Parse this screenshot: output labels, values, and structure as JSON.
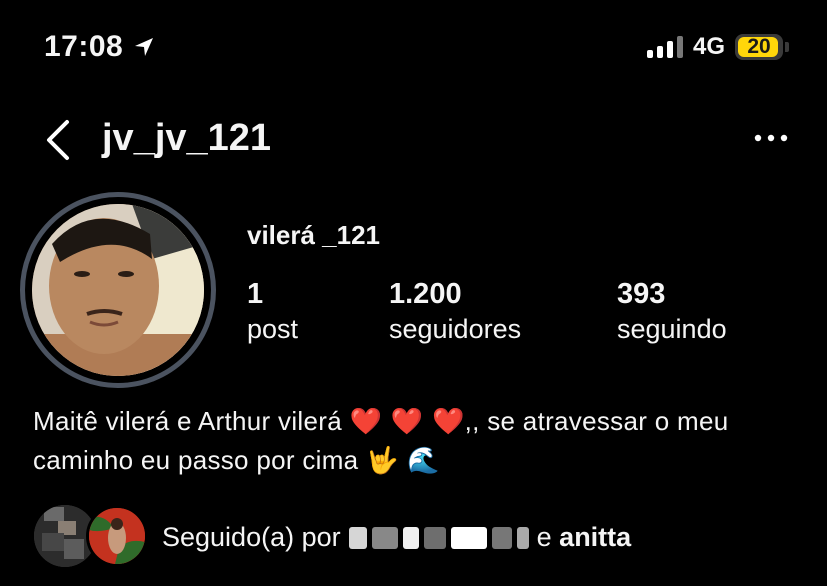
{
  "status_bar": {
    "time": "17:08",
    "network": "4G",
    "battery": "20"
  },
  "header": {
    "username": "jv_jv_121"
  },
  "profile": {
    "display_name": "vilerá _121",
    "stats": [
      {
        "value": "1",
        "label": "post"
      },
      {
        "value": "1.200",
        "label": "seguidores"
      },
      {
        "value": "393",
        "label": "seguindo"
      }
    ],
    "bio_line1": "Maitê vilerá e Arthur vilerá",
    "bio_hearts": "❤️ ❤️ ❤️",
    "bio_line1_rest": ",, se atravessar o meu",
    "bio_line2": "caminho eu passo por cima",
    "bio_line2_emojis": "🤟 🌊"
  },
  "followed_by": {
    "prefix": "Seguido(a) por",
    "connector": "e",
    "name": "anitta"
  },
  "colors": {
    "background": "#000000",
    "text": "#f5f5f5",
    "battery": "#ffd60a",
    "avatar_ring": "#4b5360"
  }
}
